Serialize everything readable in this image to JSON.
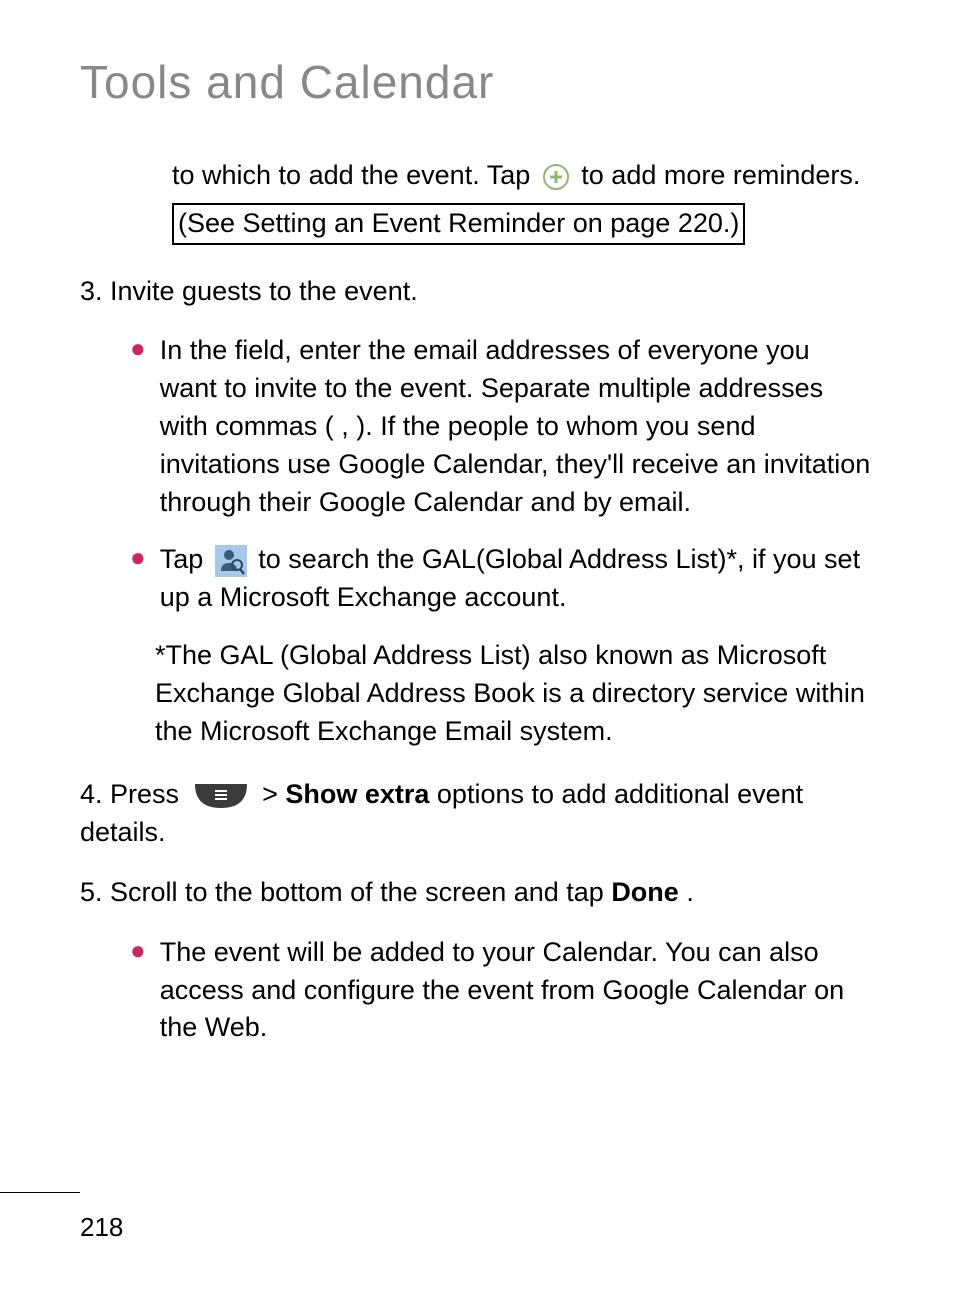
{
  "title": "Tools and Calendar",
  "continuation": {
    "line1_prefix": "to which to add the event. Tap ",
    "line1_suffix": " to add more reminders.",
    "link": "(See Setting an Event Reminder on page 220.)"
  },
  "step3": {
    "number": "3. Invite guests to the event.",
    "bullet1": "In the field, enter the email addresses of everyone you want to invite to the event. Separate multiple addresses with commas ( , ). If the people to whom you send invitations use Google Calendar, they'll receive an invitation through their Google Calendar and by email.",
    "bullet2_prefix": "Tap ",
    "bullet2_suffix": " to search the GAL(Global Address List)*, if you set up a Microsoft Exchange account.",
    "footnote": "*The GAL (Global Address List) also known as Microsoft Exchange Global Address Book is a directory service within the Microsoft Exchange Email system."
  },
  "step4": {
    "prefix": "4. Press ",
    "middle": " > ",
    "bold": "Show extra",
    "suffix": " options to add additional event details."
  },
  "step5": {
    "prefix": "5. Scroll to the bottom of the screen and tap ",
    "bold": "Done",
    "suffix": ".",
    "bullet": "The event will be added to your Calendar. You can also access and configure the event from Google Calendar on the Web."
  },
  "pageNumber": "218"
}
